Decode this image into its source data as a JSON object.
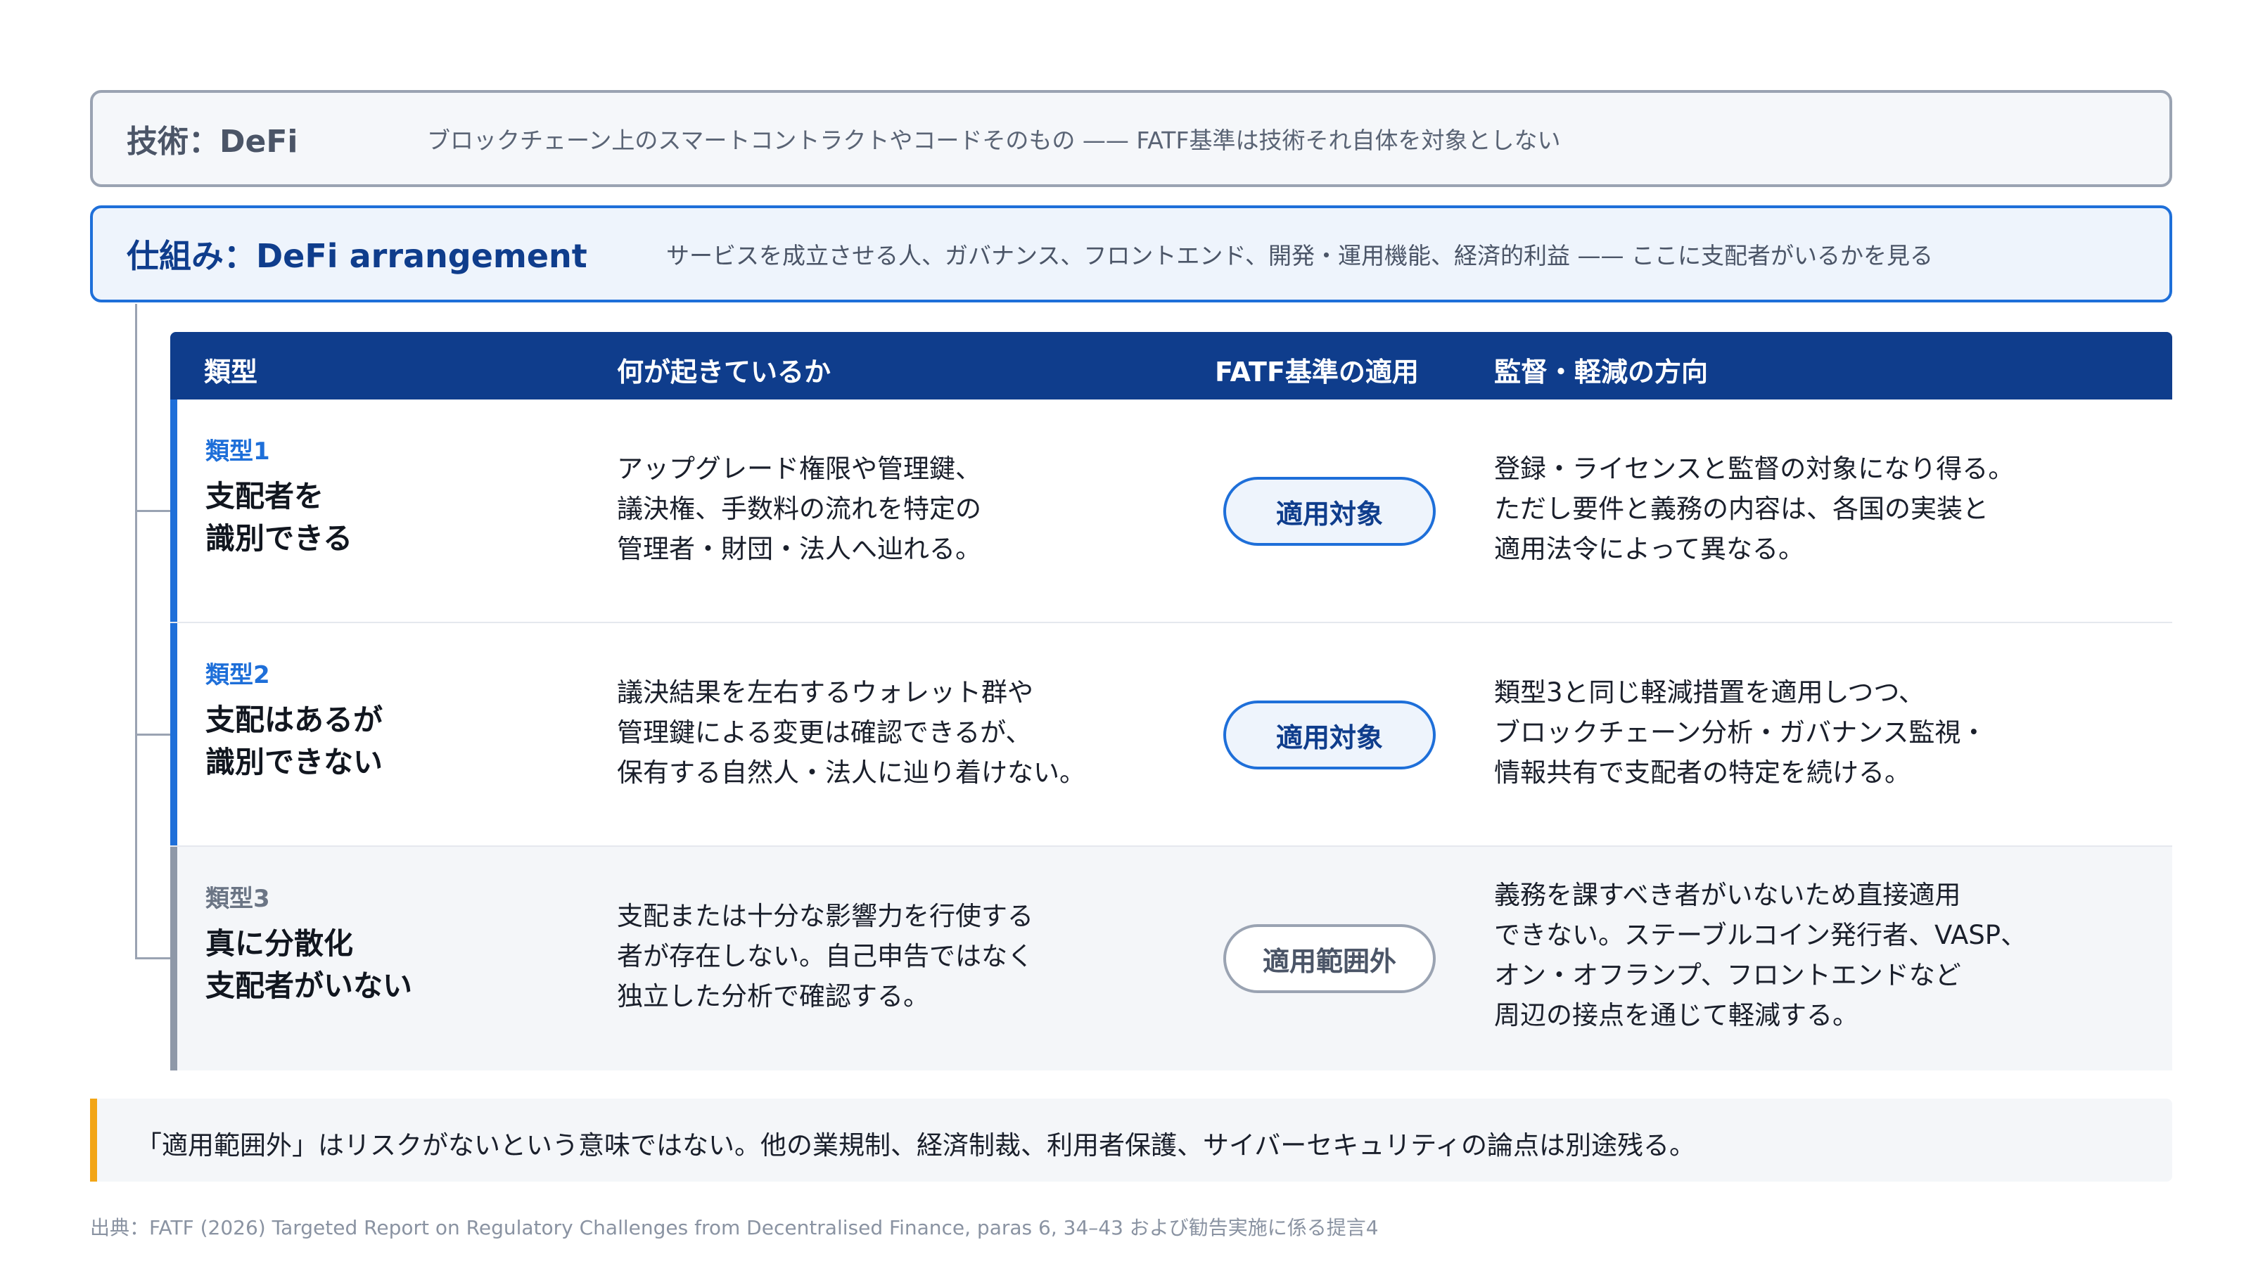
{
  "tech": {
    "title": "技術：DeFi",
    "desc": "ブロックチェーン上のスマートコントラクトやコードそのもの —— FATF基準は技術それ自体を対象としない"
  },
  "arrangement": {
    "title": "仕組み：DeFi arrangement",
    "desc": "サービスを成立させる人、ガバナンス、フロントエンド、開発・運用機能、経済的利益 —— ここに支配者がいるかを見る"
  },
  "table": {
    "headers": [
      "類型",
      "何が起きているか",
      "FATF基準の適用",
      "監督・軽減の方向"
    ],
    "rows": [
      {
        "label": "類型1",
        "name": "支配者を\n識別できる",
        "what": "アップグレード権限や管理鍵、\n議決権、手数料の流れを特定の\n管理者・財団・法人へ辿れる。",
        "status": "適用対象",
        "direction": "登録・ライセンスと監督の対象になり得る。\nただし要件と義務の内容は、各国の実装と\n適用法令によって異なる。"
      },
      {
        "label": "類型2",
        "name": "支配はあるが\n識別できない",
        "what": "議決結果を左右するウォレット群や\n管理鍵による変更は確認できるが、\n保有する自然人・法人に辿り着けない。",
        "status": "適用対象",
        "direction": "類型3と同じ軽減措置を適用しつつ、\nブロックチェーン分析・ガバナンス監視・\n情報共有で支配者の特定を続ける。"
      },
      {
        "label": "類型3",
        "name": "真に分散化\n支配者がいない",
        "what": "支配または十分な影響力を行使する\n者が存在しない。自己申告ではなく\n独立した分析で確認する。",
        "status": "適用範囲外",
        "direction": "義務を課すべき者がいないため直接適用\nできない。ステーブルコイン発行者、VASP、\nオン・オフランプ、フロントエンドなど\n周辺の接点を通じて軽減する。"
      }
    ]
  },
  "note": "「適用範囲外」はリスクがないという意味ではない。他の業規制、経済制裁、利用者保護、サイバーセキュリティの論点は別途残る。",
  "source": "出典：FATF (2026) Targeted Report on Regulatory Challenges from Decentralised Finance, paras 6, 34–43 および勧告実施に係る提言4",
  "colors": {
    "accent": "#1e6fd9",
    "header": "#0f3d8c",
    "muted": "#9aa3b2",
    "note_bar": "#f2a516"
  }
}
